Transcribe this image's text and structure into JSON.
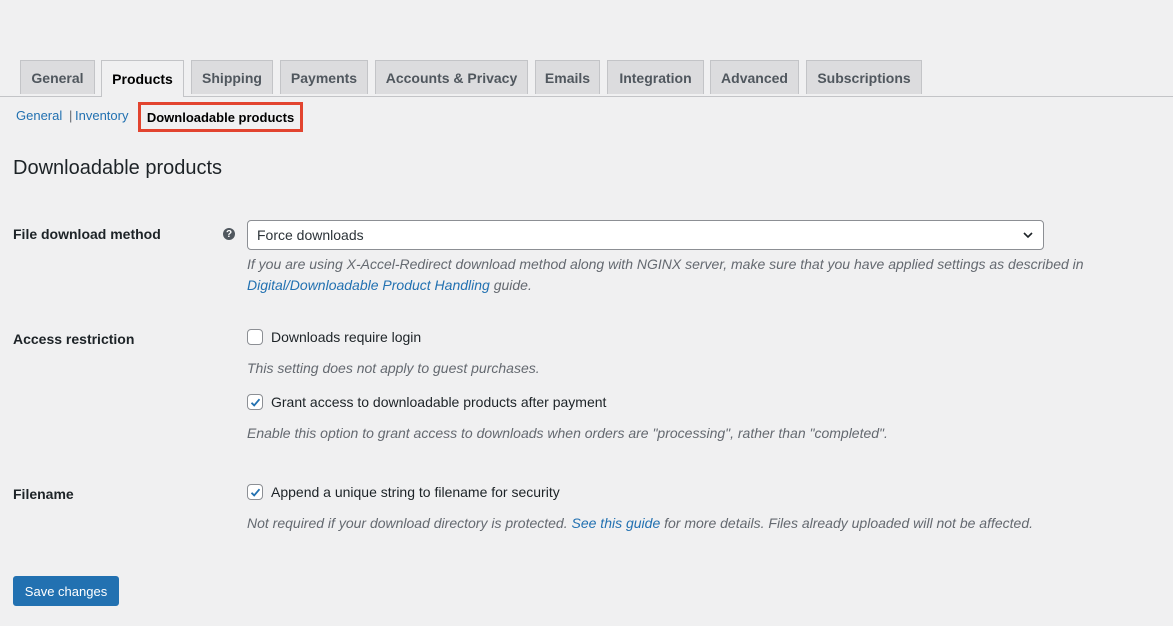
{
  "tabs": [
    {
      "label": "General",
      "active": false
    },
    {
      "label": "Products",
      "active": true
    },
    {
      "label": "Shipping",
      "active": false
    },
    {
      "label": "Payments",
      "active": false
    },
    {
      "label": "Accounts & Privacy",
      "active": false
    },
    {
      "label": "Emails",
      "active": false
    },
    {
      "label": "Integration",
      "active": false
    },
    {
      "label": "Advanced",
      "active": false
    },
    {
      "label": "Subscriptions",
      "active": false
    }
  ],
  "subnav": {
    "general": "General",
    "separator": "|",
    "inventory": "Inventory",
    "current": "Downloadable products"
  },
  "section_title": "Downloadable products",
  "file_download": {
    "label": "File download method",
    "help_icon": "question-circle-icon",
    "selected": "Force downloads",
    "desc_text": "If you are using X-Accel-Redirect download method along with NGINX server, make sure that you have applied settings as described in",
    "desc_link": "Digital/Downloadable Product Handling",
    "desc_suffix": "guide."
  },
  "access_restriction": {
    "label": "Access restriction",
    "require_login": {
      "label": "Downloads require login",
      "checked": false
    },
    "require_login_desc": "This setting does not apply to guest purchases.",
    "grant_access": {
      "label": "Grant access to downloadable products after payment",
      "checked": true
    },
    "grant_access_desc": "Enable this option to grant access to downloads when orders are \"processing\", rather than \"completed\"."
  },
  "filename": {
    "label": "Filename",
    "append_string": {
      "label": "Append a unique string to filename for security",
      "checked": true
    },
    "desc_prefix": "Not required if your download directory is protected.",
    "desc_link": "See this guide",
    "desc_suffix": "for more details. Files already uploaded will not be affected."
  },
  "save_button": "Save changes",
  "colors": {
    "accent": "#2271b1",
    "highlight_border": "#e2442f",
    "background": "#f0f0f1"
  }
}
